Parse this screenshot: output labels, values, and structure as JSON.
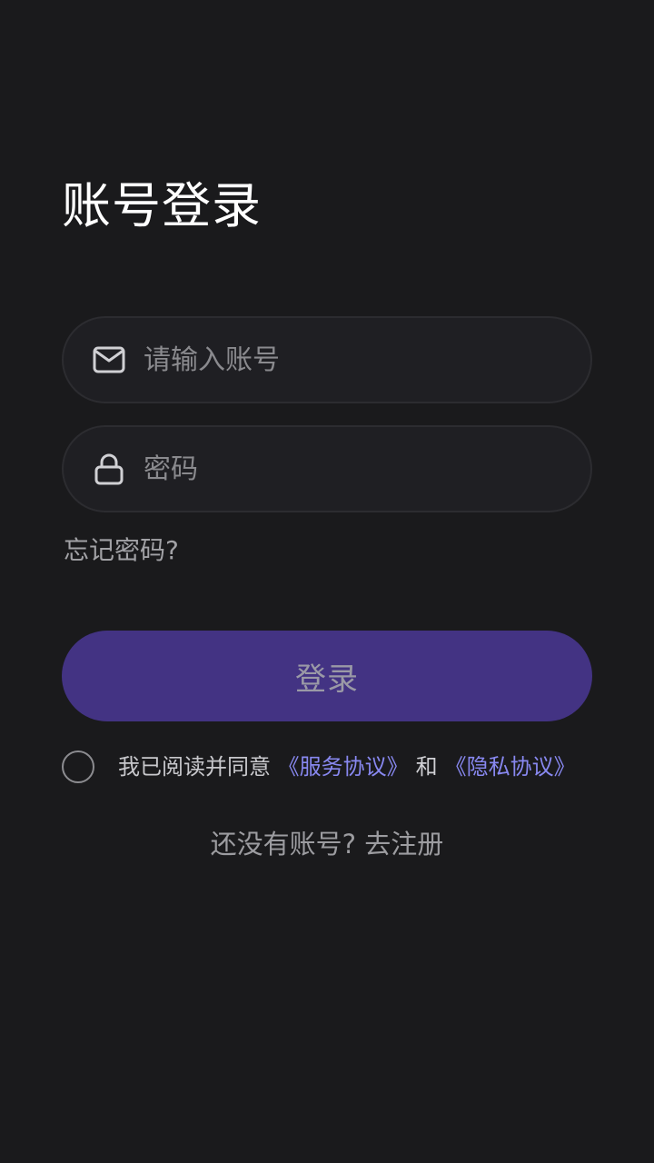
{
  "page": {
    "title": "账号登录"
  },
  "account": {
    "placeholder": "请输入账号",
    "value": "",
    "icon": "mail-icon"
  },
  "password": {
    "placeholder": "密码",
    "value": "",
    "icon": "lock-icon"
  },
  "forgot_label": "忘记密码?",
  "login": {
    "label": "登录"
  },
  "agreement": {
    "checked": false,
    "prefix": "我已阅读并同意",
    "service_link": "《服务协议》",
    "and": "和",
    "privacy_link": "《隐私协议》"
  },
  "register": {
    "prompt": "还没有账号?",
    "link": "去注册"
  },
  "colors": {
    "background": "#1a1a1c",
    "input_background": "#1f1f23",
    "primary_button": "#433383",
    "link": "#8888f0"
  }
}
